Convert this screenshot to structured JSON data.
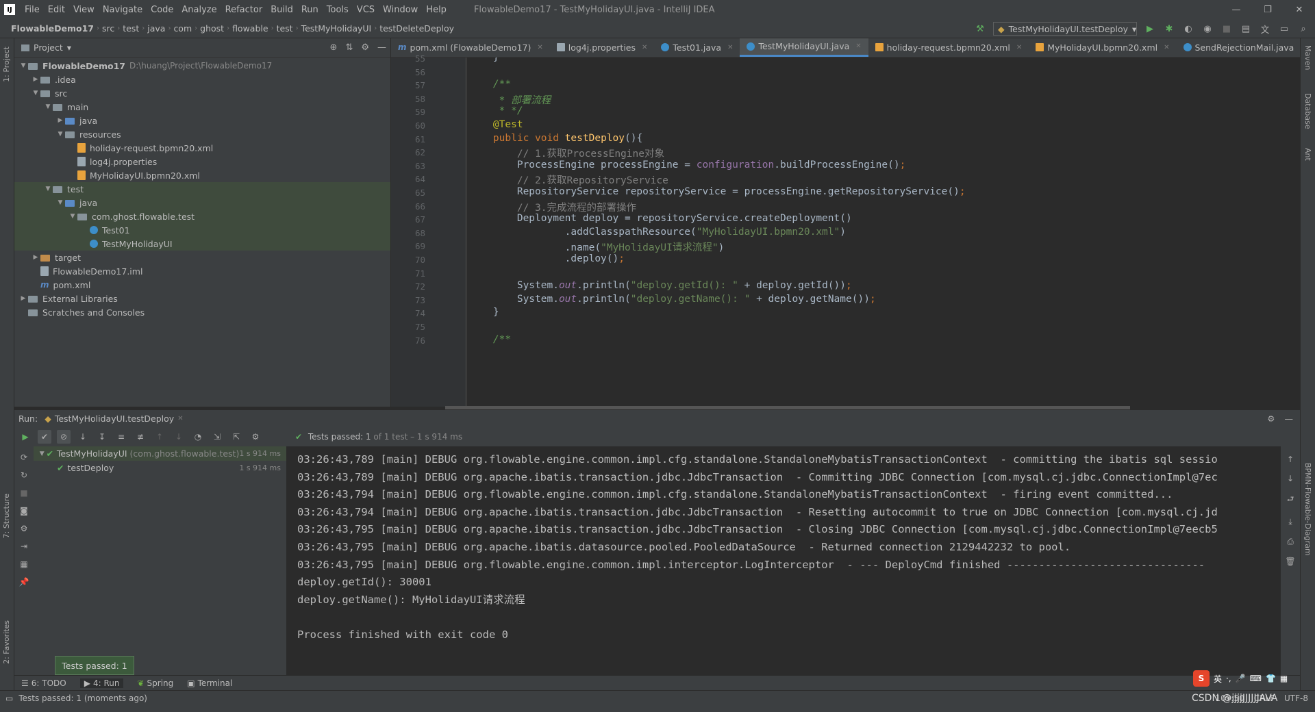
{
  "window": {
    "title": "FlowableDemo17 - TestMyHolidayUI.java - IntelliJ IDEA",
    "logo": "IJ"
  },
  "menu": [
    "File",
    "Edit",
    "View",
    "Navigate",
    "Code",
    "Analyze",
    "Refactor",
    "Build",
    "Run",
    "Tools",
    "VCS",
    "Window",
    "Help"
  ],
  "breadcrumbs": [
    "FlowableDemo17",
    "src",
    "test",
    "java",
    "com",
    "ghost",
    "flowable",
    "test",
    "TestMyHolidayUI",
    "testDeleteDeploy"
  ],
  "run_config": "TestMyHolidayUI.testDeploy",
  "project": {
    "header": "Project",
    "tree": [
      {
        "label": "FlowableDemo17",
        "path": "D:\\huang\\Project\\FlowableDemo17",
        "depth": 0,
        "arrow": "▼",
        "type": "folder"
      },
      {
        "label": ".idea",
        "depth": 1,
        "arrow": "▶",
        "type": "folder"
      },
      {
        "label": "src",
        "depth": 1,
        "arrow": "▼",
        "type": "folder"
      },
      {
        "label": "main",
        "depth": 2,
        "arrow": "▼",
        "type": "folder"
      },
      {
        "label": "java",
        "depth": 3,
        "arrow": "▶",
        "type": "folder-blue"
      },
      {
        "label": "resources",
        "depth": 3,
        "arrow": "▼",
        "type": "folder"
      },
      {
        "label": "holiday-request.bpmn20.xml",
        "depth": 4,
        "arrow": "",
        "type": "xml"
      },
      {
        "label": "log4j.properties",
        "depth": 4,
        "arrow": "",
        "type": "prop"
      },
      {
        "label": "MyHolidayUI.bpmn20.xml",
        "depth": 4,
        "arrow": "",
        "type": "xml"
      },
      {
        "label": "test",
        "depth": 2,
        "arrow": "▼",
        "type": "folder"
      },
      {
        "label": "java",
        "depth": 3,
        "arrow": "▼",
        "type": "folder-blue"
      },
      {
        "label": "com.ghost.flowable.test",
        "depth": 4,
        "arrow": "▼",
        "type": "folder"
      },
      {
        "label": "Test01",
        "depth": 5,
        "arrow": "",
        "type": "java"
      },
      {
        "label": "TestMyHolidayUI",
        "depth": 5,
        "arrow": "",
        "type": "java"
      },
      {
        "label": "target",
        "depth": 1,
        "arrow": "▶",
        "type": "folder-orange"
      },
      {
        "label": "FlowableDemo17.iml",
        "depth": 1,
        "arrow": "",
        "type": "prop"
      },
      {
        "label": "pom.xml",
        "depth": 1,
        "arrow": "",
        "type": "m"
      },
      {
        "label": "External Libraries",
        "depth": 0,
        "arrow": "▶",
        "type": "folder"
      },
      {
        "label": "Scratches and Consoles",
        "depth": 0,
        "arrow": "",
        "type": "folder"
      }
    ]
  },
  "tabs": [
    {
      "label": "pom.xml (FlowableDemo17)",
      "type": "m"
    },
    {
      "label": "log4j.properties",
      "type": "prop"
    },
    {
      "label": "Test01.java",
      "type": "java"
    },
    {
      "label": "TestMyHolidayUI.java",
      "type": "java",
      "active": true
    },
    {
      "label": "holiday-request.bpmn20.xml",
      "type": "xml"
    },
    {
      "label": "MyHolidayUI.bpmn20.xml",
      "type": "xml"
    },
    {
      "label": "SendRejectionMail.java",
      "type": "java"
    }
  ],
  "code": {
    "line_numbers": [
      "55",
      "56",
      "57",
      "58",
      "59",
      "60",
      "61",
      "62",
      "63",
      "64",
      "65",
      "66",
      "67",
      "68",
      "69",
      "70",
      "71",
      "72",
      "73",
      "74",
      "75",
      "76"
    ],
    "lines": [
      [
        {
          "t": "    }",
          "c": ""
        }
      ],
      [
        {
          "t": "",
          "c": ""
        }
      ],
      [
        {
          "t": "    /**",
          "c": "doc"
        }
      ],
      [
        {
          "t": "     * 部署流程",
          "c": "doc"
        }
      ],
      [
        {
          "t": "     * */",
          "c": "doc"
        }
      ],
      [
        {
          "t": "    @Test",
          "c": "ann"
        }
      ],
      [
        {
          "t": "    public void ",
          "c": "kw"
        },
        {
          "t": "testDeploy",
          "c": "fn"
        },
        {
          "t": "(){",
          "c": ""
        }
      ],
      [
        {
          "t": "        // 1.获取ProcessEngine对象",
          "c": "cm"
        }
      ],
      [
        {
          "t": "        ProcessEngine processEngine = ",
          "c": ""
        },
        {
          "t": "configuration",
          "c": "fld"
        },
        {
          "t": ".buildProcessEngine()",
          "c": ""
        },
        {
          "t": ";",
          "c": "kw"
        }
      ],
      [
        {
          "t": "        // 2.获取RepositoryService",
          "c": "cm"
        }
      ],
      [
        {
          "t": "        RepositoryService repositoryService = processEngine.getRepositoryService()",
          "c": ""
        },
        {
          "t": ";",
          "c": "kw"
        }
      ],
      [
        {
          "t": "        // 3.完成流程的部署操作",
          "c": "cm"
        }
      ],
      [
        {
          "t": "        Deployment deploy = repositoryService.createDeployment()",
          "c": ""
        }
      ],
      [
        {
          "t": "                .addClasspathResource(",
          "c": ""
        },
        {
          "t": "\"MyHolidayUI.bpmn20.xml\"",
          "c": "str"
        },
        {
          "t": ")",
          "c": ""
        }
      ],
      [
        {
          "t": "                .name(",
          "c": ""
        },
        {
          "t": "\"MyHolidayUI请求流程\"",
          "c": "str"
        },
        {
          "t": ")",
          "c": ""
        }
      ],
      [
        {
          "t": "                .deploy()",
          "c": ""
        },
        {
          "t": ";",
          "c": "kw"
        }
      ],
      [
        {
          "t": "",
          "c": ""
        }
      ],
      [
        {
          "t": "        System.",
          "c": ""
        },
        {
          "t": "out",
          "c": "st"
        },
        {
          "t": ".println(",
          "c": ""
        },
        {
          "t": "\"deploy.getId(): \"",
          "c": "str"
        },
        {
          "t": " + deploy.getId())",
          "c": ""
        },
        {
          "t": ";",
          "c": "kw"
        }
      ],
      [
        {
          "t": "        System.",
          "c": ""
        },
        {
          "t": "out",
          "c": "st"
        },
        {
          "t": ".println(",
          "c": ""
        },
        {
          "t": "\"deploy.getName(): \"",
          "c": "str"
        },
        {
          "t": " + deploy.getName())",
          "c": ""
        },
        {
          "t": ";",
          "c": "kw"
        }
      ],
      [
        {
          "t": "    }",
          "c": ""
        }
      ],
      [
        {
          "t": "",
          "c": ""
        }
      ],
      [
        {
          "t": "    /**",
          "c": "doc"
        }
      ]
    ]
  },
  "run": {
    "label": "Run:",
    "tab": "TestMyHolidayUI.testDeploy",
    "status_prefix": "Tests passed:",
    "status_count": "1",
    "status_rest": "of 1 test – 1 s 914 ms",
    "tests": [
      {
        "name": "TestMyHolidayUI",
        "pkg": "(com.ghost.flowable.test)",
        "duration": "1 s 914 ms"
      },
      {
        "name": "testDeploy",
        "duration": "1 s 914 ms"
      }
    ],
    "console": [
      "03:26:43,789 [main] DEBUG org.flowable.engine.common.impl.cfg.standalone.StandaloneMybatisTransactionContext  - committing the ibatis sql sessio",
      "03:26:43,789 [main] DEBUG org.apache.ibatis.transaction.jdbc.JdbcTransaction  - Committing JDBC Connection [com.mysql.cj.jdbc.ConnectionImpl@7ec",
      "03:26:43,794 [main] DEBUG org.flowable.engine.common.impl.cfg.standalone.StandaloneMybatisTransactionContext  - firing event committed...",
      "03:26:43,794 [main] DEBUG org.apache.ibatis.transaction.jdbc.JdbcTransaction  - Resetting autocommit to true on JDBC Connection [com.mysql.cj.jd",
      "03:26:43,795 [main] DEBUG org.apache.ibatis.transaction.jdbc.JdbcTransaction  - Closing JDBC Connection [com.mysql.cj.jdbc.ConnectionImpl@7eecb5",
      "03:26:43,795 [main] DEBUG org.apache.ibatis.datasource.pooled.PooledDataSource  - Returned connection 2129442232 to pool.",
      "03:26:43,795 [main] DEBUG org.flowable.engine.common.impl.interceptor.LogInterceptor  - --- DeployCmd finished -------------------------------",
      "deploy.getId(): 30001",
      "deploy.getName(): MyHolidayUI请求流程",
      "",
      "Process finished with exit code 0"
    ]
  },
  "toast": "Tests passed: 1",
  "bottom_tabs": [
    "6: TODO",
    "4: Run",
    "Spring",
    "Terminal"
  ],
  "status": {
    "message": "Tests passed: 1 (moments ago)",
    "position": "109:50",
    "line_sep": "CRLF",
    "encoding": "UTF-8"
  },
  "side_tabs": {
    "left": [
      "1: Project",
      "7: Structure",
      "2: Favorites"
    ],
    "right": [
      "Maven",
      "Database",
      "Ant",
      "BPMN-Flowable-Diagram"
    ]
  },
  "ime": {
    "lang": "英",
    "watermark": "CSDN @jjjjJJJJJJAVA"
  },
  "colors": {
    "accent": "#4a88c7",
    "pass": "#5fb05f",
    "bg": "#2b2b2b",
    "panel": "#3c3f41"
  }
}
